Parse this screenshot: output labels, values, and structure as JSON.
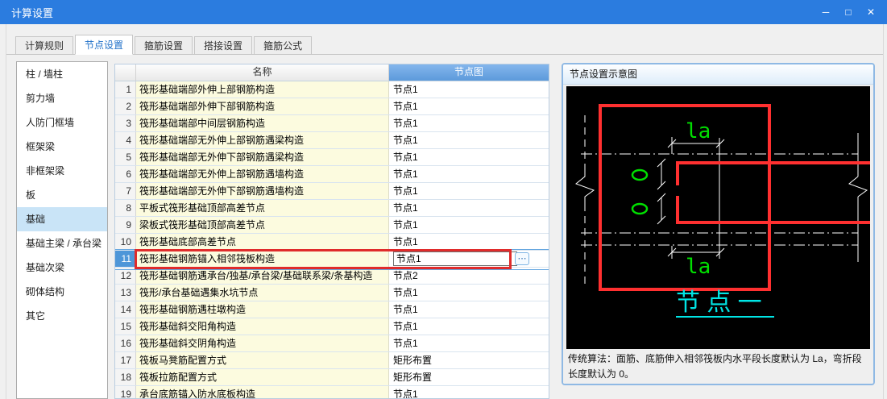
{
  "window": {
    "title": "计算设置",
    "controls": {
      "minimize": "─",
      "maximize": "□",
      "close": "✕"
    }
  },
  "tabs": [
    {
      "label": "计算规则",
      "active": false
    },
    {
      "label": "节点设置",
      "active": true
    },
    {
      "label": "箍筋设置",
      "active": false
    },
    {
      "label": "搭接设置",
      "active": false
    },
    {
      "label": "箍筋公式",
      "active": false
    }
  ],
  "sidebar": {
    "items": [
      {
        "label": "柱 / 墙柱",
        "selected": false
      },
      {
        "label": "剪力墙",
        "selected": false
      },
      {
        "label": "人防门框墙",
        "selected": false
      },
      {
        "label": "框架梁",
        "selected": false
      },
      {
        "label": "非框架梁",
        "selected": false
      },
      {
        "label": "板",
        "selected": false
      },
      {
        "label": "基础",
        "selected": true
      },
      {
        "label": "基础主梁 / 承台梁",
        "selected": false
      },
      {
        "label": "基础次梁",
        "selected": false
      },
      {
        "label": "砌体结构",
        "selected": false
      },
      {
        "label": "其它",
        "selected": false
      }
    ]
  },
  "table": {
    "columns": {
      "name": "名称",
      "node": "节点图"
    },
    "editor_ellipsis": "⋯",
    "rows": [
      {
        "num": "1",
        "name": "筏形基础端部外伸上部钢筋构造",
        "value": "节点1",
        "selected": false
      },
      {
        "num": "2",
        "name": "筏形基础端部外伸下部钢筋构造",
        "value": "节点1",
        "selected": false
      },
      {
        "num": "3",
        "name": "筏形基础端部中间层钢筋构造",
        "value": "节点1",
        "selected": false
      },
      {
        "num": "4",
        "name": "筏形基础端部无外伸上部钢筋遇梁构造",
        "value": "节点1",
        "selected": false
      },
      {
        "num": "5",
        "name": "筏形基础端部无外伸下部钢筋遇梁构造",
        "value": "节点1",
        "selected": false
      },
      {
        "num": "6",
        "name": "筏形基础端部无外伸上部钢筋遇墙构造",
        "value": "节点1",
        "selected": false
      },
      {
        "num": "7",
        "name": "筏形基础端部无外伸下部钢筋遇墙构造",
        "value": "节点1",
        "selected": false
      },
      {
        "num": "8",
        "name": "平板式筏形基础顶部高差节点",
        "value": "节点1",
        "selected": false
      },
      {
        "num": "9",
        "name": "梁板式筏形基础顶部高差节点",
        "value": "节点1",
        "selected": false
      },
      {
        "num": "10",
        "name": "筏形基础底部高差节点",
        "value": "节点1",
        "selected": false
      },
      {
        "num": "11",
        "name": "筏形基础钢筋锚入相邻筏板构造",
        "value": "节点1",
        "selected": true
      },
      {
        "num": "12",
        "name": "筏形基础钢筋遇承台/独基/承台梁/基础联系梁/条基构造",
        "value": "节点2",
        "selected": false
      },
      {
        "num": "13",
        "name": "筏形/承台基础遇集水坑节点",
        "value": "节点1",
        "selected": false
      },
      {
        "num": "14",
        "name": "筏形基础钢筋遇柱墩构造",
        "value": "节点1",
        "selected": false
      },
      {
        "num": "15",
        "name": "筏形基础斜交阳角构造",
        "value": "节点1",
        "selected": false
      },
      {
        "num": "16",
        "name": "筏形基础斜交阴角构造",
        "value": "节点1",
        "selected": false
      },
      {
        "num": "17",
        "name": "筏板马凳筋配置方式",
        "value": "矩形布置",
        "selected": false
      },
      {
        "num": "18",
        "name": "筏板拉筋配置方式",
        "value": "矩形布置",
        "selected": false
      },
      {
        "num": "19",
        "name": "承台底筋锚入防水底板构造",
        "value": "节点1",
        "selected": false
      }
    ]
  },
  "detail_panel": {
    "title": "节点设置示意图",
    "note": "传统算法：面筋、底筋伸入相邻筏板内水平段长度默认为 La，弯折段长度默认为 0。",
    "diagram": {
      "label_top": "la",
      "label_bottom": "la",
      "caption": "节 点 一"
    }
  },
  "colors": {
    "titlebar_blue": "#2B7CDF",
    "active_tab_text": "#1E6FC8",
    "node_header_blue": "#6FA8E4",
    "selected_row_red": "#E02B2B",
    "sidebar_selected": "#C9E4F7",
    "name_cell_yellow": "#FCFBDF",
    "diagram_red": "#FF3030",
    "diagram_green": "#00DF00",
    "diagram_cyan": "#00E5E5",
    "diagram_background": "#000000"
  }
}
